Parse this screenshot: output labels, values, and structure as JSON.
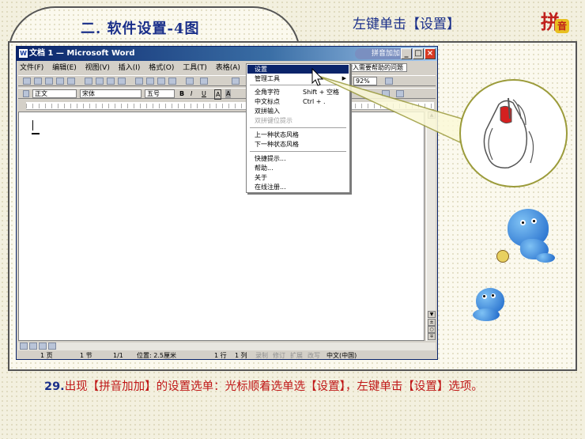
{
  "slide": {
    "title": "二. 软件设置-4图",
    "hint": "左键单击【设置】",
    "logo_main": "拼",
    "logo_sub": "音",
    "caption_number": "29.",
    "caption_text": "出现【拼音加加】的设置选单：光标顺着选单选【设置】，左键单击【设置】选项。"
  },
  "word": {
    "title": "文档 1 — Microsoft Word",
    "ime_badge": "拼音加加",
    "menus": [
      "文件(F)",
      "编辑(E)",
      "视图(V)",
      "插入(I)",
      "格式(O)",
      "工具(T)",
      "表格(A)",
      "窗"
    ],
    "style_value": "正文",
    "font_value": "宋体",
    "size_value": "五号",
    "zoom_value": "92%",
    "help_hint": "键入需要帮助的问题",
    "format_buttons": [
      "B",
      "I",
      "U",
      "A",
      "A"
    ],
    "status": {
      "page": "1 页",
      "section": "1 节",
      "count": "1/1",
      "position": "位置: 2.5厘米",
      "line": "1 行",
      "col": "1 列",
      "rec": "录制",
      "trk": "修订",
      "ext": "扩展",
      "ovr": "改写",
      "lang": "中文(中国)"
    }
  },
  "ime_menu": {
    "items": [
      {
        "label": "设置",
        "shortcut": "",
        "state": "selected"
      },
      {
        "label": "管理工具",
        "shortcut": "",
        "state": "submenu"
      },
      {
        "label": "全角字符",
        "shortcut": "Shift + 空格",
        "state": "normal"
      },
      {
        "label": "中文标点",
        "shortcut": "Ctrl + .",
        "state": "normal"
      },
      {
        "label": "双拼输入",
        "shortcut": "",
        "state": "normal"
      },
      {
        "label": "双拼键位提示",
        "shortcut": "",
        "state": "disabled"
      },
      {
        "label": "上一种状态风格",
        "shortcut": "",
        "state": "normal"
      },
      {
        "label": "下一种状态风格",
        "shortcut": "",
        "state": "normal"
      },
      {
        "label": "快捷提示...",
        "shortcut": "",
        "state": "normal"
      },
      {
        "label": "帮助...",
        "shortcut": "",
        "state": "normal"
      },
      {
        "label": "关于",
        "shortcut": "",
        "state": "normal"
      },
      {
        "label": "在线注册...",
        "shortcut": "",
        "state": "normal"
      }
    ]
  },
  "colors": {
    "title_blue": "#1a2f8a",
    "caption_red": "#c01818",
    "menu_highlight": "#0a246a",
    "dolphin_blue": "#1a64c8"
  }
}
